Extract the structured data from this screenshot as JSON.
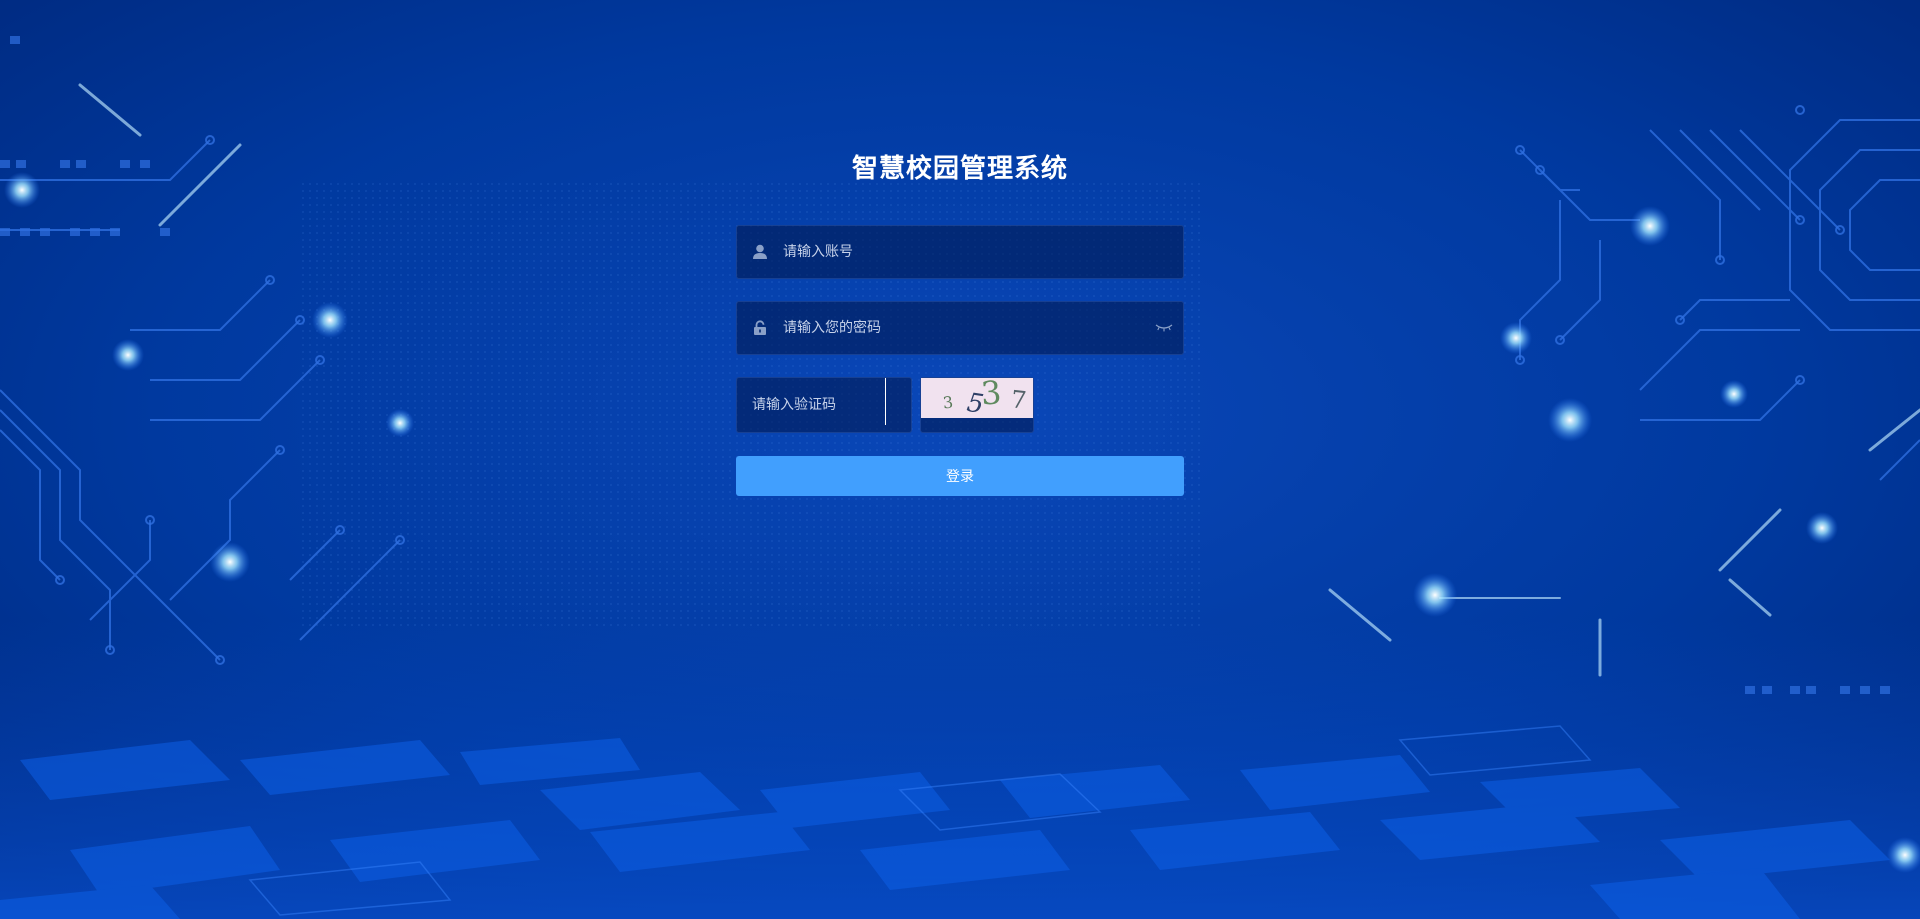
{
  "page": {
    "title": "智慧校园管理系统"
  },
  "form": {
    "account": {
      "placeholder": "请输入账号",
      "value": "",
      "icon": "user-icon"
    },
    "password": {
      "placeholder": "请输入您的密码",
      "value": "",
      "icon": "lock-icon",
      "toggle_icon": "eye-closed-icon"
    },
    "captcha": {
      "placeholder": "请输入验证码",
      "value": "",
      "image_chars": [
        "3",
        "5",
        "3",
        "7"
      ]
    },
    "submit_label": "登录"
  },
  "colors": {
    "background": "#003391",
    "button": "#419ffe",
    "title": "#ffffff",
    "captcha_bg": "#f1e2ef"
  }
}
